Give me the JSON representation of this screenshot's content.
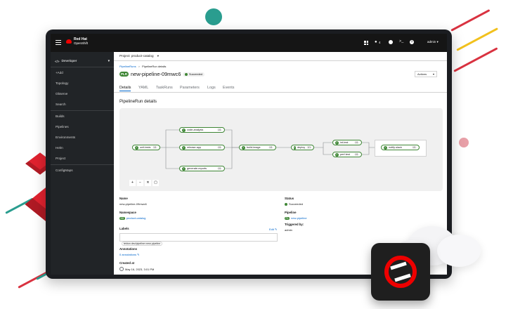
{
  "colors": {
    "accent": "#0066cc",
    "success": "#3e8635",
    "brand_red": "#ee0000",
    "masthead": "#151515",
    "sidebar": "#212427"
  },
  "masthead": {
    "brand_line1": "Red Hat",
    "brand_line2": "OpenShift",
    "notification_count": "4",
    "user": "admin",
    "icons": [
      "grid-icon",
      "bell-icon",
      "plus-icon",
      "terminal-icon",
      "help-icon"
    ]
  },
  "sidebar": {
    "perspective": "Developer",
    "items": [
      "+Add",
      "Topology",
      "Observe",
      "Search",
      "Builds",
      "Pipelines",
      "Environments",
      "Helm",
      "Project",
      "ConfigMaps"
    ]
  },
  "project_bar": {
    "label": "Project: product-catalog"
  },
  "breadcrumb": {
    "root": "PipelineRuns",
    "sep": ">",
    "current": "PipelineRun details"
  },
  "header": {
    "badge": "PLR",
    "title": "new-pipeline-09mwc6",
    "status": "Succeeded",
    "actions": "Actions"
  },
  "tabs": [
    "Details",
    "YAML",
    "TaskRuns",
    "Parameters",
    "Logs",
    "Events"
  ],
  "section_title": "PipelineRun details",
  "graph": {
    "nodes": [
      {
        "label": "unit-tests",
        "badge": "1/1"
      },
      {
        "label": "code-analysis",
        "badge": "1/1"
      },
      {
        "label": "release-app",
        "badge": "1/1"
      },
      {
        "label": "generate-reports",
        "badge": "1/1"
      },
      {
        "label": "build-image",
        "badge": "1/1"
      },
      {
        "label": "deploy",
        "badge": "1/1"
      },
      {
        "label": "int-test",
        "badge": "1/1"
      },
      {
        "label": "perf-test",
        "badge": "1/1"
      },
      {
        "label": "notify-slack",
        "badge": "1/1"
      }
    ],
    "controls": [
      "zoom-in-icon",
      "zoom-out-icon",
      "fit-icon",
      "expand-icon"
    ]
  },
  "details": {
    "name_label": "Name",
    "name_value": "new-pipeline-09mwc6",
    "namespace_label": "Namespace",
    "namespace_badge": "NS",
    "namespace_value": "product-catalog",
    "labels_label": "Labels",
    "labels_edit": "Edit",
    "label_chip": "tekton.dev/pipeline=new-pipeline",
    "annotations_label": "Annotations",
    "annotations_value": "0 annotations",
    "created_label": "Created at",
    "created_value": "May 16, 2023, 3:01 PM",
    "status_label": "Status",
    "status_value": "Succeeded",
    "pipeline_label": "Pipeline",
    "pipeline_badge": "PL",
    "pipeline_value": "new-pipeline",
    "triggered_label": "Triggered by:",
    "triggered_value": "admin"
  }
}
